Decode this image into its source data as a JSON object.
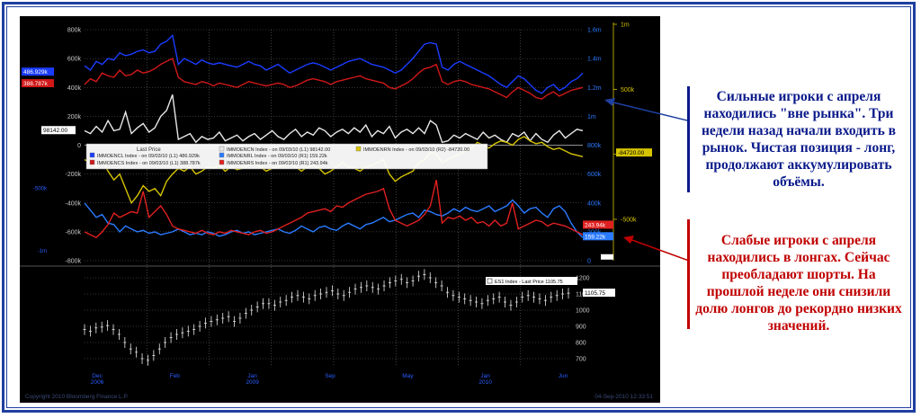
{
  "colors": {
    "panel_bg": "#000000",
    "blue_series": "#1a3cff",
    "red_series": "#d01818",
    "white_series": "#e8e8e8",
    "yellow_series": "#d6c400",
    "ll_blue": "#2a7bff",
    "ll_red": "#e02020",
    "callout_blue": "#0a1a8a",
    "callout_red": "#c00000"
  },
  "chart_data": [
    {
      "type": "line",
      "left_axis_ticks": [
        "800k",
        "600k",
        "400k",
        "200k",
        "0",
        "-200k",
        "-400k",
        "-600k",
        "-800k"
      ],
      "left_axis_values": [
        800,
        600,
        400,
        200,
        0,
        -200,
        -400,
        -600,
        -800
      ],
      "left_extra_ticks": [
        "-500k",
        "-1m"
      ],
      "right_axis_ticks": [
        "1.6m",
        "1.4m",
        "1.2m",
        "1m",
        "800k",
        "600k",
        "400k",
        "200k",
        "0"
      ],
      "far_right_axis_ticks": [
        "1m",
        "500k",
        "0",
        "-500k"
      ],
      "ylim": [
        -800,
        800
      ],
      "legend": {
        "title": "Last Price",
        "entries": [
          "IMMOENCL Index - on 09/03/10 (L1) 486.929k",
          "IMMOENCS Index - on 09/03/10 (L1) 388.787k",
          "IMMOENCN Index - on 09/03/10 (L1) 98142.00",
          "IMMOENRL Index - on 09/03/10 (R1) 159.22k",
          "IMMOENRS Index - on 09/03/10 (R1) 243.94k",
          "IMMOENRN Index - on 09/03/10 (R2) -84720.00"
        ]
      },
      "value_tags": {
        "left_blue": "486.929k",
        "left_red": "388.787k",
        "left_white": "98142.00",
        "right_red": "243.94k",
        "right_blue": "159.22k",
        "right_yellow": "-84720.00"
      },
      "series": [
        {
          "name": "IMMOENCL Index",
          "axis": "left",
          "values": [
            550,
            520,
            580,
            560,
            600,
            590,
            640,
            620,
            630,
            650,
            660,
            640,
            650,
            700,
            720,
            760,
            560,
            600,
            580,
            560,
            590,
            570,
            560,
            570,
            560,
            550,
            540,
            560,
            580,
            560,
            550,
            520,
            540,
            560,
            530,
            500,
            520,
            540,
            560,
            570,
            560,
            540,
            520,
            540,
            560,
            580,
            590,
            600,
            580,
            560,
            550,
            540,
            520,
            500,
            520,
            560,
            600,
            650,
            700,
            710,
            700,
            540,
            520,
            560,
            580,
            560,
            540,
            520,
            500,
            480,
            450,
            420,
            400,
            440,
            480,
            460,
            420,
            380,
            360,
            400,
            420,
            380,
            400,
            440,
            460,
            500
          ]
        },
        {
          "name": "IMMOENCS Index",
          "axis": "left",
          "values": [
            420,
            460,
            440,
            500,
            480,
            470,
            520,
            480,
            490,
            520,
            500,
            510,
            530,
            560,
            580,
            600,
            470,
            440,
            430,
            420,
            440,
            430,
            410,
            430,
            420,
            410,
            400,
            420,
            440,
            430,
            420,
            410,
            420,
            430,
            420,
            400,
            410,
            430,
            450,
            460,
            450,
            440,
            420,
            440,
            450,
            460,
            470,
            480,
            460,
            450,
            440,
            430,
            400,
            390,
            410,
            430,
            460,
            500,
            530,
            540,
            560,
            440,
            420,
            440,
            450,
            440,
            420,
            410,
            400,
            390,
            370,
            350,
            330,
            370,
            400,
            380,
            360,
            330,
            320,
            350,
            370,
            340,
            360,
            380,
            390,
            400
          ]
        },
        {
          "name": "IMMOENCN Index",
          "axis": "left",
          "values": [
            100,
            80,
            130,
            90,
            170,
            100,
            110,
            230,
            80,
            120,
            150,
            90,
            120,
            200,
            240,
            350,
            40,
            60,
            80,
            20,
            60,
            40,
            50,
            90,
            30,
            50,
            70,
            30,
            60,
            80,
            40,
            70,
            100,
            60,
            40,
            80,
            110,
            60,
            90,
            70,
            120,
            100,
            60,
            90,
            110,
            80,
            120,
            90,
            140,
            60,
            100,
            80,
            130,
            50,
            90,
            110,
            80,
            120,
            80,
            170,
            140,
            20,
            30,
            70,
            50,
            80,
            60,
            40,
            90,
            50,
            70,
            40,
            20,
            80,
            60,
            90,
            30,
            80,
            40,
            20,
            70,
            100,
            50,
            80,
            110,
            100
          ]
        },
        {
          "name": "IMMOENRL Index",
          "axis": "right",
          "values": [
            -400,
            -450,
            -500,
            -480,
            -540,
            -550,
            -600,
            -560,
            -580,
            -600,
            -590,
            -610,
            -600,
            -620,
            -610,
            -600,
            -580,
            -600,
            -620,
            -610,
            -620,
            -600,
            -610,
            -630,
            -620,
            -600,
            -590,
            -610,
            -600,
            -620,
            -610,
            -600,
            -590,
            -580,
            -600,
            -610,
            -590,
            -560,
            -580,
            -600,
            -570,
            -560,
            -580,
            -590,
            -560,
            -540,
            -560,
            -580,
            -550,
            -540,
            -520,
            -500,
            -530,
            -520,
            -500,
            -480,
            -470,
            -500,
            -450,
            -460,
            -480,
            -490,
            -470,
            -440,
            -460,
            -430,
            -450,
            -460,
            -440,
            -420,
            -460,
            -440,
            -420,
            -380,
            -420,
            -470,
            -440,
            -430,
            -470,
            -500,
            -440,
            -420,
            -460,
            -540,
            -600,
            -640
          ]
        },
        {
          "name": "IMMOENRS Index",
          "axis": "right",
          "values": [
            -600,
            -620,
            -640,
            -600,
            -550,
            -470,
            -500,
            -480,
            -460,
            -470,
            -320,
            -500,
            -460,
            -420,
            -480,
            -560,
            -580,
            -590,
            -600,
            -610,
            -590,
            -610,
            -620,
            -600,
            -610,
            -590,
            -600,
            -610,
            -620,
            -600,
            -590,
            -610,
            -600,
            -580,
            -560,
            -540,
            -520,
            -500,
            -470,
            -460,
            -450,
            -440,
            -460,
            -420,
            -430,
            -400,
            -380,
            -360,
            -340,
            -330,
            -320,
            -300,
            -440,
            -520,
            -540,
            -560,
            -540,
            -520,
            -480,
            -420,
            -240,
            -540,
            -500,
            -510,
            -490,
            -520,
            -500,
            -540,
            -530,
            -560,
            -520,
            -560,
            -540,
            -400,
            -580,
            -560,
            -540,
            -520,
            -530,
            -560,
            -540,
            -550,
            -560,
            -580,
            -600,
            -620
          ]
        },
        {
          "name": "IMMOENRN Index",
          "axis": "right2",
          "values": [
            -100,
            -120,
            -150,
            -100,
            -180,
            -240,
            -200,
            -300,
            -400,
            -350,
            -280,
            -320,
            -300,
            -350,
            -250,
            -200,
            -160,
            -180,
            -150,
            -200,
            -180,
            -150,
            -160,
            -140,
            -180,
            -150,
            -170,
            -160,
            -140,
            -130,
            -150,
            -180,
            -160,
            -150,
            -140,
            -120,
            -150,
            -180,
            -150,
            -140,
            -160,
            -200,
            -180,
            -150,
            -120,
            -150,
            -160,
            -180,
            -150,
            -140,
            -120,
            -100,
            -200,
            -250,
            -220,
            -200,
            -180,
            -120,
            -100,
            -50,
            -60,
            -120,
            -100,
            -80,
            -60,
            -40,
            -20,
            20,
            0,
            -20,
            10,
            30,
            20,
            0,
            40,
            60,
            30,
            10,
            20,
            -10,
            -30,
            -20,
            -40,
            -60,
            -70,
            -80
          ]
        }
      ]
    },
    {
      "type": "line",
      "legend": "ES1 Index - Last Price  1105.75",
      "value_tag": "1105.75",
      "y_ticks": [
        "1200",
        "1100",
        "1000",
        "900",
        "800",
        "700"
      ],
      "ylim": [
        650,
        1250
      ],
      "x_ticks": [
        "Dec\n2006",
        "Feb",
        "Jan\n2009",
        "Sep",
        "May",
        "Jan\n2010",
        "Jun"
      ],
      "series": [
        {
          "name": "ES1 Index",
          "values": [
            880,
            870,
            890,
            895,
            905,
            880,
            850,
            800,
            760,
            740,
            700,
            690,
            720,
            760,
            800,
            830,
            850,
            860,
            870,
            880,
            900,
            920,
            930,
            940,
            950,
            960,
            930,
            950,
            980,
            1000,
            1020,
            1040,
            1040,
            1030,
            1050,
            1060,
            1080,
            1090,
            1080,
            1070,
            1090,
            1100,
            1110,
            1120,
            1100,
            1090,
            1110,
            1130,
            1140,
            1150,
            1140,
            1130,
            1150,
            1170,
            1180,
            1190,
            1170,
            1180,
            1210,
            1220,
            1200,
            1170,
            1150,
            1110,
            1090,
            1080,
            1070,
            1060,
            1050,
            1040,
            1060,
            1070,
            1080,
            1050,
            1030,
            1050,
            1080,
            1090,
            1080,
            1070,
            1060,
            1080,
            1090,
            1100,
            1105
          ]
        }
      ]
    }
  ],
  "footer_left": "Copyright 2010 Bloomberg Finance L.P.",
  "footer_right": "04-Sep-2010 12:33:51",
  "callouts": {
    "blue_lines": [
      "Сильные игроки с апреля",
      "находились \"вне рынка\". Три",
      "недели назад начали входить в",
      "рынок. Чистая позиция - лонг,",
      "продолжают аккумулировать",
      "объёмы."
    ],
    "red_lines": [
      "Слабые игроки с апреля",
      "находились в лонгах. Сейчас",
      "преобладают шорты. На",
      "прошлой неделе они снизили",
      "долю лонгов до рекордно низких",
      "значений."
    ]
  }
}
